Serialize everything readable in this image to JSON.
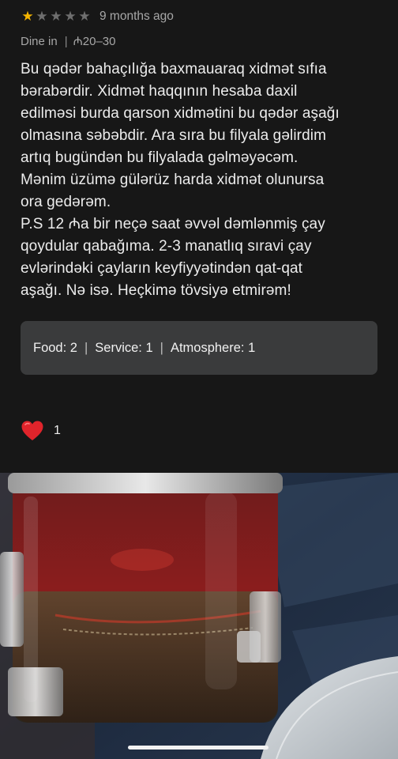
{
  "review": {
    "stars": {
      "rating": 1,
      "max": 5
    },
    "time_ago": "9 months ago",
    "dining_type": "Dine in",
    "price_range": "₼20–30",
    "text": "Bu qədər bahaçılığa baxmauaraq xidmət sıfıa\nbərabərdir. Xidmət haqqının hesaba daxil\nedilməsi burda qarson xidmətini bu qədər aşağı\nolmasına səbəbdir. Ara sıra bu filyala gəlirdim\nartıq bugündən bu filyalada gəlməyəcəm.\nMənim üzümə gülərüz harda xidmət olunursa\nora gedərəm.\nP.S 12 ₼a bir neçə saat əvvəl dəmlənmiş çay\nqoydular qabağıma. 2-3 manatlıq sıravi çay\nevlərindəki çayların keyfiyyətindən qat-qat\naşağı. Nə isə. Heçkimə tövsiyə etmirəm!",
    "scores": {
      "food": "Food: 2",
      "service": "Service: 1",
      "atmosphere": "Atmosphere: 1",
      "divider": "|"
    },
    "reactions": {
      "icon": "heart-icon",
      "count": "1"
    }
  },
  "photo": {
    "subject": "tea-in-glass-teapot"
  },
  "colors": {
    "star_filled": "#f4b400",
    "star_empty": "#6e6e6e",
    "background": "#171717",
    "score_box": "#3a3b3c",
    "heart": "#e0242b"
  }
}
